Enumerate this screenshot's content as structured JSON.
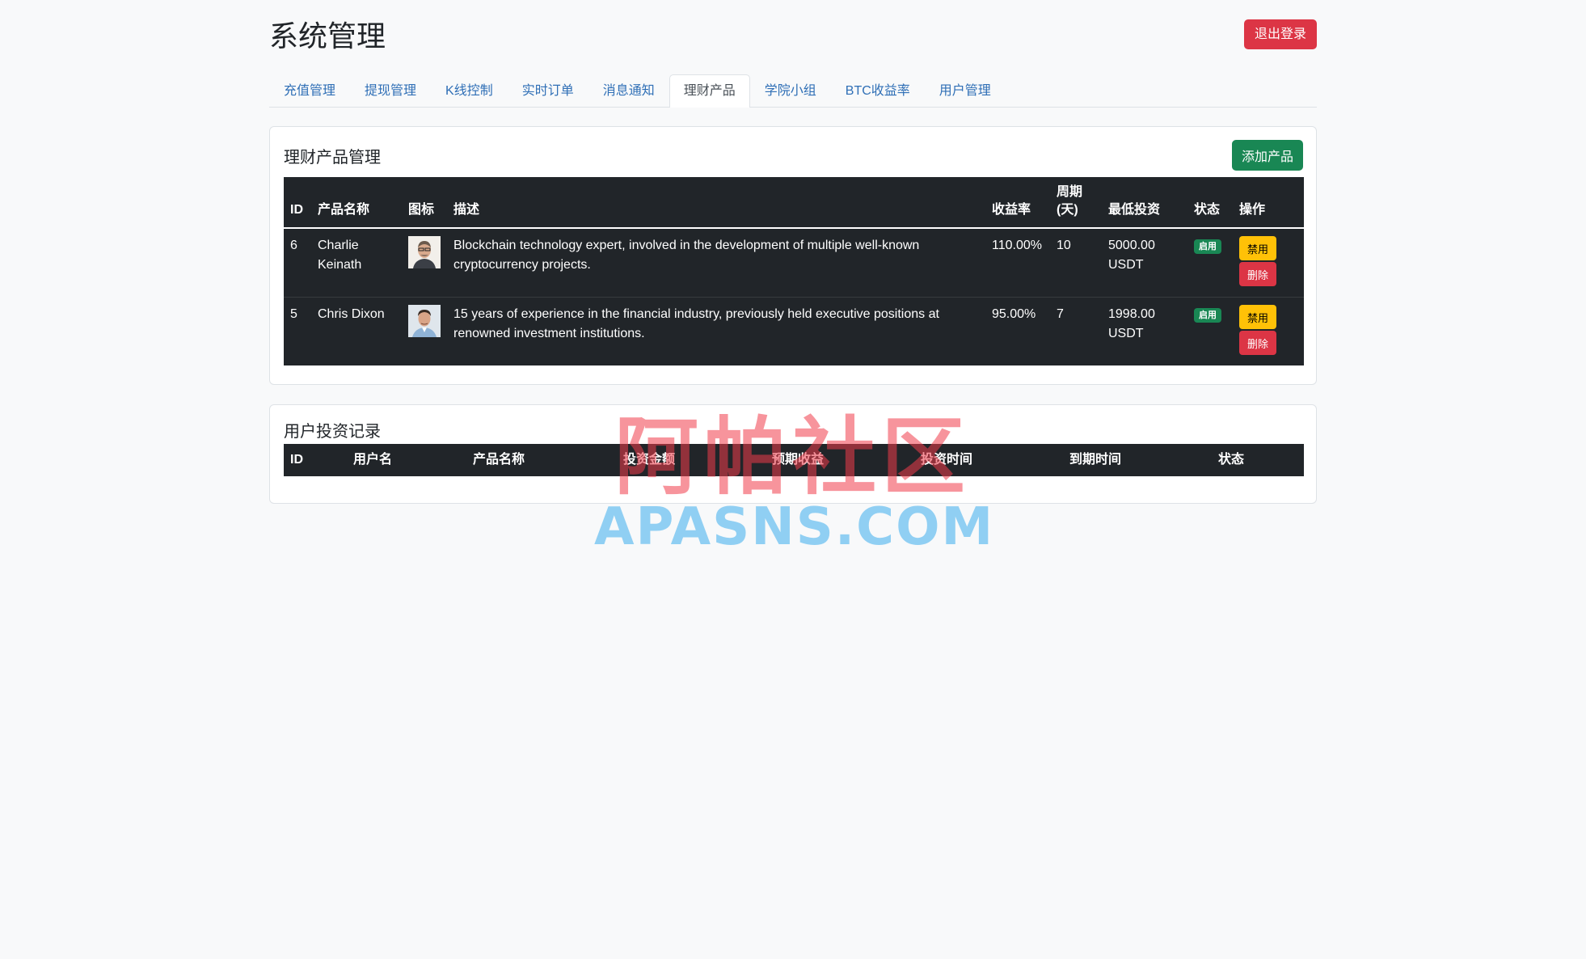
{
  "header": {
    "title": "系统管理",
    "logout_label": "退出登录"
  },
  "tabs": [
    {
      "label": "充值管理"
    },
    {
      "label": "提现管理"
    },
    {
      "label": "K线控制"
    },
    {
      "label": "实时订单"
    },
    {
      "label": "消息通知"
    },
    {
      "label": "理财产品",
      "active": true
    },
    {
      "label": "学院小组"
    },
    {
      "label": "BTC收益率"
    },
    {
      "label": "用户管理"
    }
  ],
  "products": {
    "title": "理财产品管理",
    "add_label": "添加产品",
    "columns": [
      "ID",
      "产品名称",
      "图标",
      "描述",
      "收益率",
      "周期(天)",
      "最低投资",
      "状态",
      "操作"
    ],
    "rows": [
      {
        "id": "6",
        "name": "Charlie Keinath",
        "icon": "person-photo-icon",
        "description": "Blockchain technology expert, involved in the development of multiple well-known cryptocurrency projects.",
        "rate": "110.00%",
        "period": "10",
        "min_invest": "5000.00 USDT",
        "status": "启用",
        "action_disable": "禁用",
        "action_delete": "删除"
      },
      {
        "id": "5",
        "name": "Chris Dixon",
        "icon": "person-photo-icon",
        "description": "15 years of experience in the financial industry, previously held executive positions at renowned investment institutions.",
        "rate": "95.00%",
        "period": "7",
        "min_invest": "1998.00 USDT",
        "status": "启用",
        "action_disable": "禁用",
        "action_delete": "删除"
      }
    ]
  },
  "records": {
    "title": "用户投资记录",
    "columns": [
      "ID",
      "用户名",
      "产品名称",
      "投资金额",
      "预期收益",
      "投资时间",
      "到期时间",
      "状态"
    ]
  },
  "watermark": {
    "cn": "阿帕社区",
    "en": "APASNS.COM"
  },
  "colors": {
    "danger": "#dc3545",
    "success": "#198754",
    "warning": "#ffc107",
    "dark": "#212529",
    "link": "#2f6fb6"
  }
}
